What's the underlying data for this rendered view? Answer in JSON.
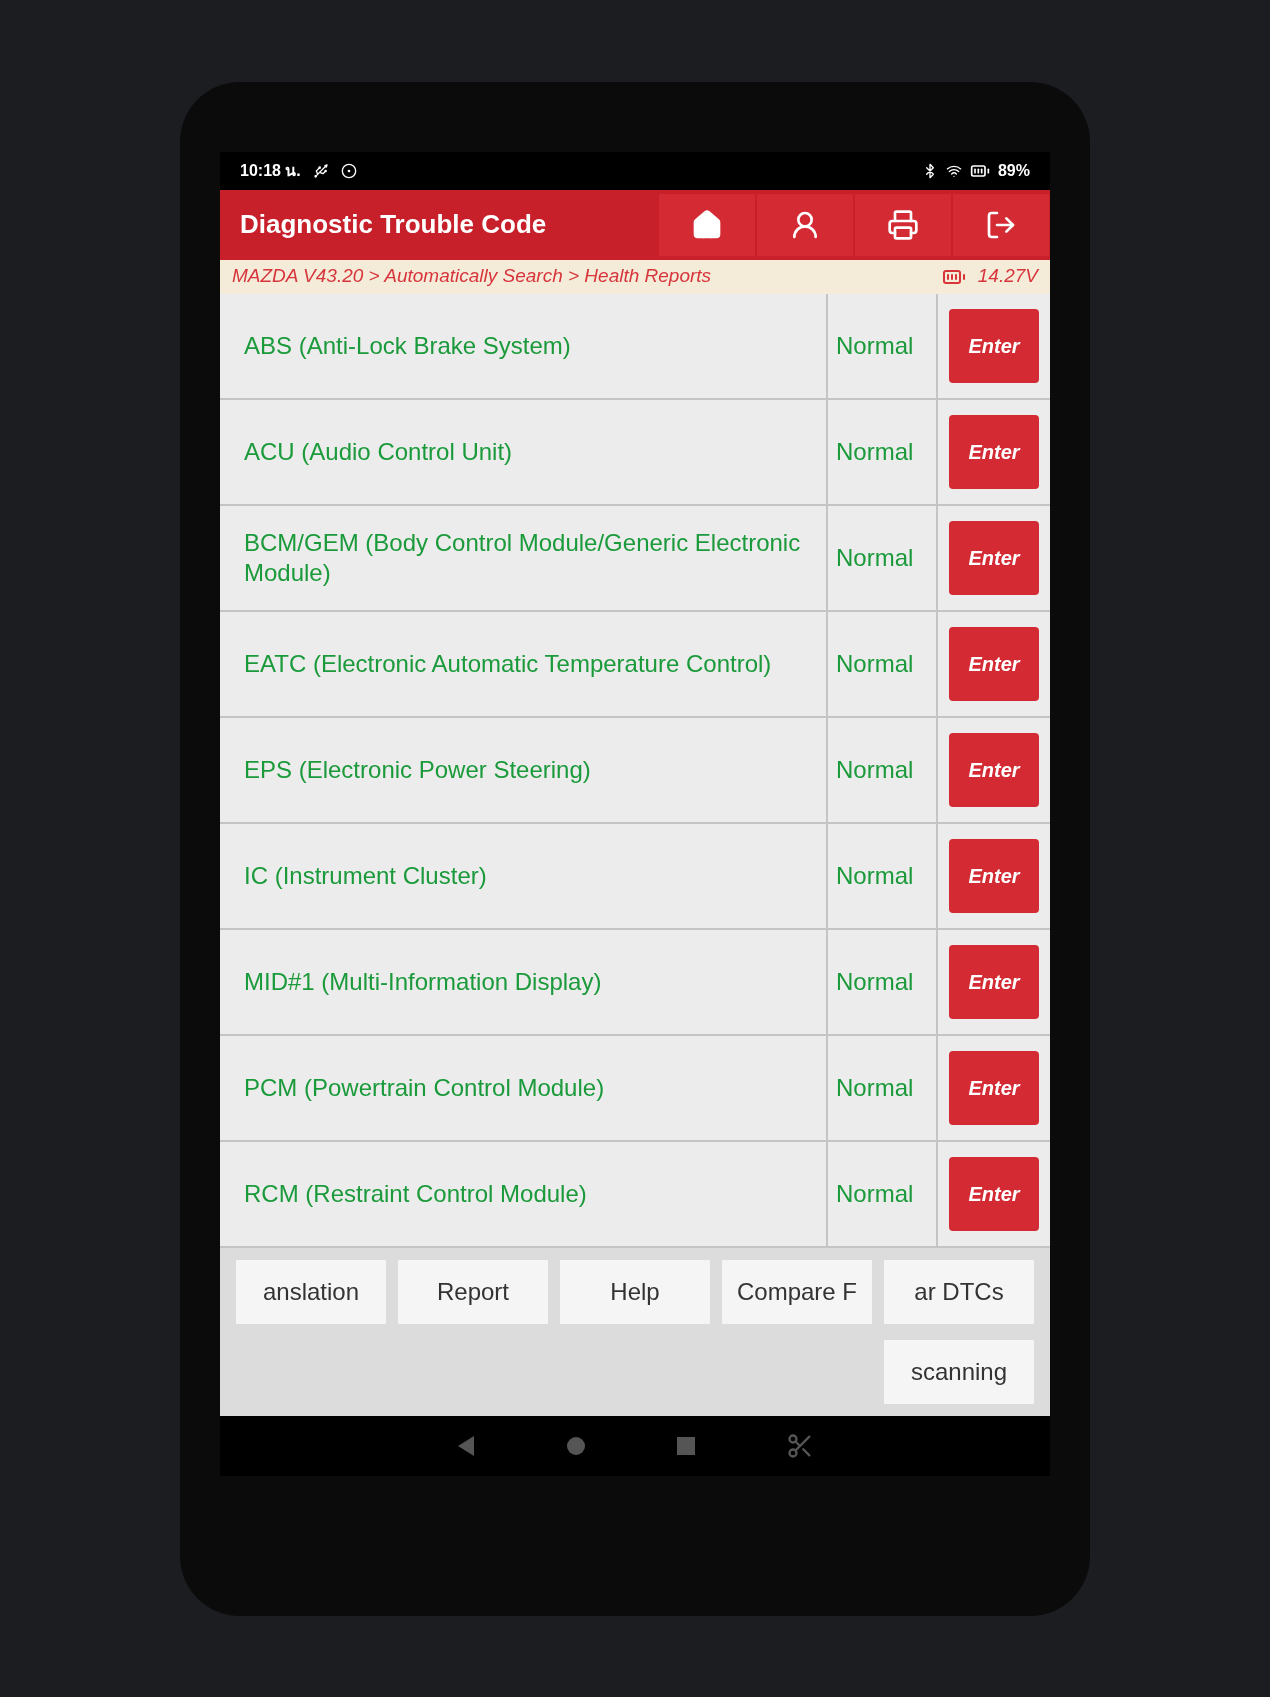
{
  "status_bar": {
    "time": "10:18 น.",
    "battery": "89%"
  },
  "header": {
    "title": "Diagnostic Trouble Code",
    "actions": [
      {
        "kind": "home"
      },
      {
        "kind": "technician"
      },
      {
        "kind": "print"
      },
      {
        "kind": "exit"
      }
    ]
  },
  "breadcrumb": {
    "path": "MAZDA V43.20 > Automatically Search > Health Reports",
    "voltage": "14.27V"
  },
  "systems": [
    {
      "name": "ABS (Anti-Lock Brake System)",
      "status": "Normal",
      "button": "Enter"
    },
    {
      "name": "ACU (Audio Control Unit)",
      "status": "Normal",
      "button": "Enter"
    },
    {
      "name": "BCM/GEM (Body Control Module/Generic Electronic Module)",
      "status": "Normal",
      "button": "Enter"
    },
    {
      "name": "EATC (Electronic Automatic Temperature Control)",
      "status": "Normal",
      "button": "Enter"
    },
    {
      "name": "EPS (Electronic Power Steering)",
      "status": "Normal",
      "button": "Enter"
    },
    {
      "name": "IC (Instrument Cluster)",
      "status": "Normal",
      "button": "Enter"
    },
    {
      "name": "MID#1 (Multi-Information Display)",
      "status": "Normal",
      "button": "Enter"
    },
    {
      "name": "PCM (Powertrain Control Module)",
      "status": "Normal",
      "button": "Enter"
    },
    {
      "name": "RCM (Restraint Control Module)",
      "status": "Normal",
      "button": "Enter"
    }
  ],
  "buttons": [
    "anslation",
    "Report",
    "Help",
    "Compare F",
    "ar DTCs"
  ],
  "second_row_buttons": [
    "scanning"
  ],
  "nav_bar": [
    {
      "kind": "back"
    },
    {
      "kind": "home"
    },
    {
      "kind": "recents"
    },
    {
      "kind": "screenshot"
    }
  ]
}
